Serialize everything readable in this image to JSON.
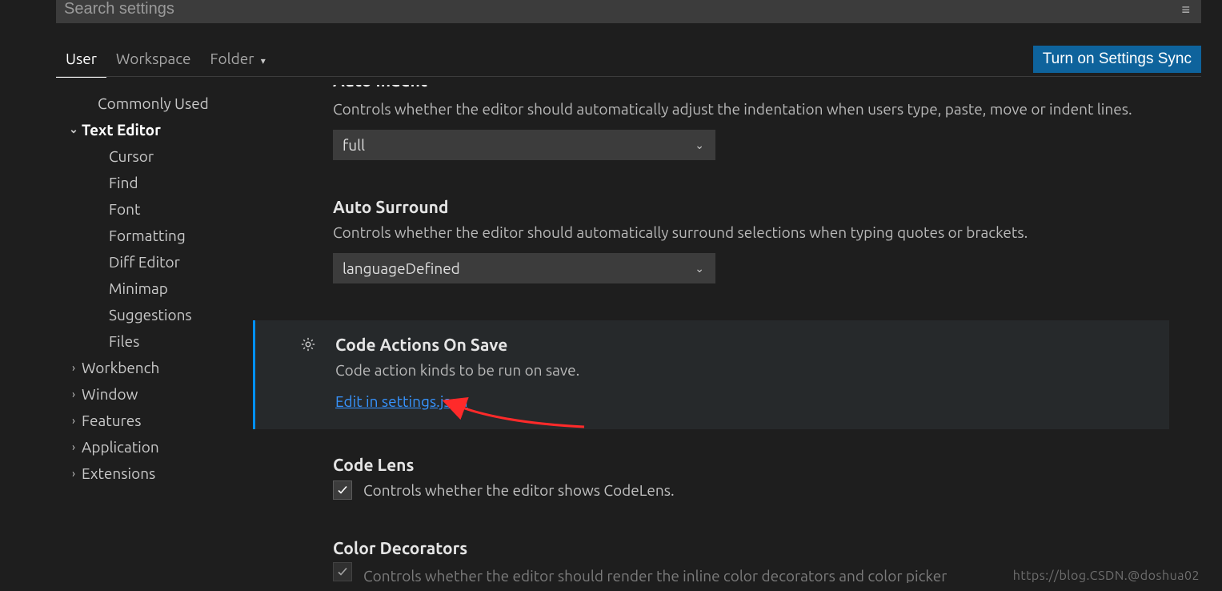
{
  "search": {
    "placeholder": "Search settings"
  },
  "scope": {
    "tabs": [
      "User",
      "Workspace",
      "Folder"
    ],
    "sync_label": "Turn on Settings Sync"
  },
  "sidebar": {
    "items": [
      {
        "label": "Commonly Used",
        "level": 1,
        "leaf": true
      },
      {
        "label": "Text Editor",
        "level": 0,
        "leaf": false,
        "expanded": true,
        "bold": true
      },
      {
        "label": "Cursor",
        "level": 2,
        "leaf": true
      },
      {
        "label": "Find",
        "level": 2,
        "leaf": true
      },
      {
        "label": "Font",
        "level": 2,
        "leaf": true
      },
      {
        "label": "Formatting",
        "level": 2,
        "leaf": true
      },
      {
        "label": "Diff Editor",
        "level": 2,
        "leaf": true
      },
      {
        "label": "Minimap",
        "level": 2,
        "leaf": true
      },
      {
        "label": "Suggestions",
        "level": 2,
        "leaf": true
      },
      {
        "label": "Files",
        "level": 2,
        "leaf": true
      },
      {
        "label": "Workbench",
        "level": 0,
        "leaf": false,
        "expanded": false
      },
      {
        "label": "Window",
        "level": 0,
        "leaf": false,
        "expanded": false
      },
      {
        "label": "Features",
        "level": 0,
        "leaf": false,
        "expanded": false
      },
      {
        "label": "Application",
        "level": 0,
        "leaf": false,
        "expanded": false
      },
      {
        "label": "Extensions",
        "level": 0,
        "leaf": false,
        "expanded": false
      }
    ]
  },
  "settings": {
    "autoIndent": {
      "title": "Auto Indent",
      "desc": "Controls whether the editor should automatically adjust the indentation when users type, paste, move or indent lines.",
      "value": "full"
    },
    "autoSurround": {
      "title": "Auto Surround",
      "desc": "Controls whether the editor should automatically surround selections when typing quotes or brackets.",
      "value": "languageDefined"
    },
    "codeActionsOnSave": {
      "title": "Code Actions On Save",
      "desc": "Code action kinds to be run on save.",
      "link": "Edit in settings.json"
    },
    "codeLens": {
      "title": "Code Lens",
      "desc": "Controls whether the editor shows CodeLens.",
      "checked": true
    },
    "colorDecorators": {
      "title": "Color Decorators",
      "desc": "Controls whether the editor should render the inline color decorators and color picker",
      "checked": true
    }
  },
  "watermark": "https://blog.CSDN.@doshua02"
}
